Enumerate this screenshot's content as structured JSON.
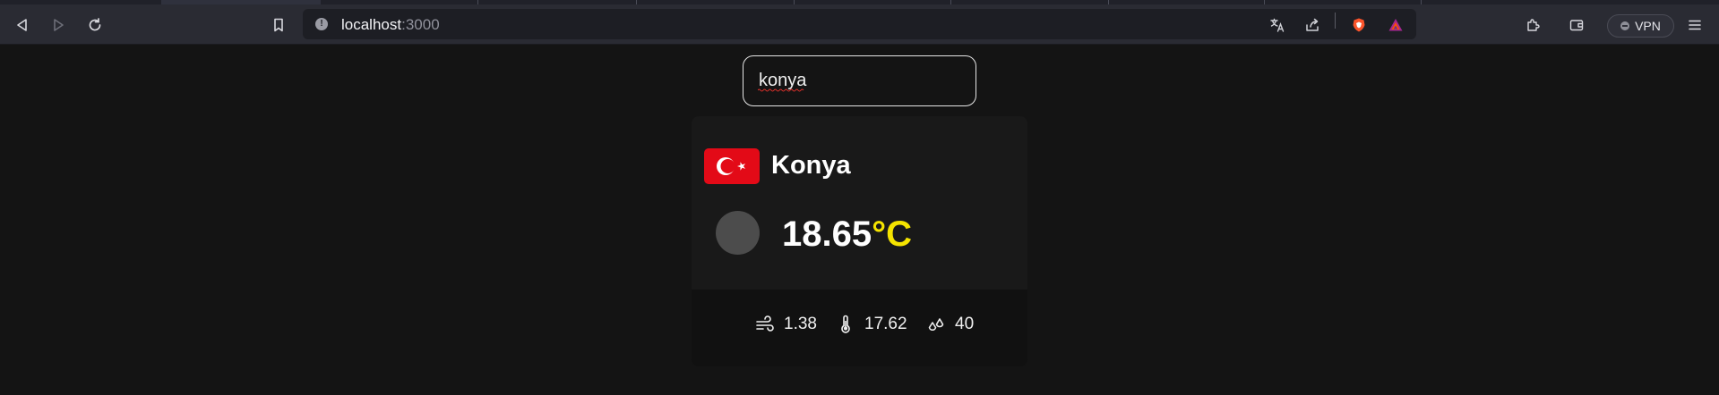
{
  "browser": {
    "url_host": "localhost",
    "url_port": ":3000",
    "vpn_label": "VPN"
  },
  "search": {
    "value": "konya"
  },
  "weather": {
    "city": "Konya",
    "country_flag": "turkey-flag",
    "temperature": "18.65",
    "unit": "°C",
    "wind_speed": "1.38",
    "feels_like": "17.62",
    "humidity": "40"
  },
  "colors": {
    "background": "#141414",
    "card": "#191919",
    "card_footer": "#111111",
    "unit_accent": "#f5e400",
    "flag_red": "#e30a17"
  }
}
